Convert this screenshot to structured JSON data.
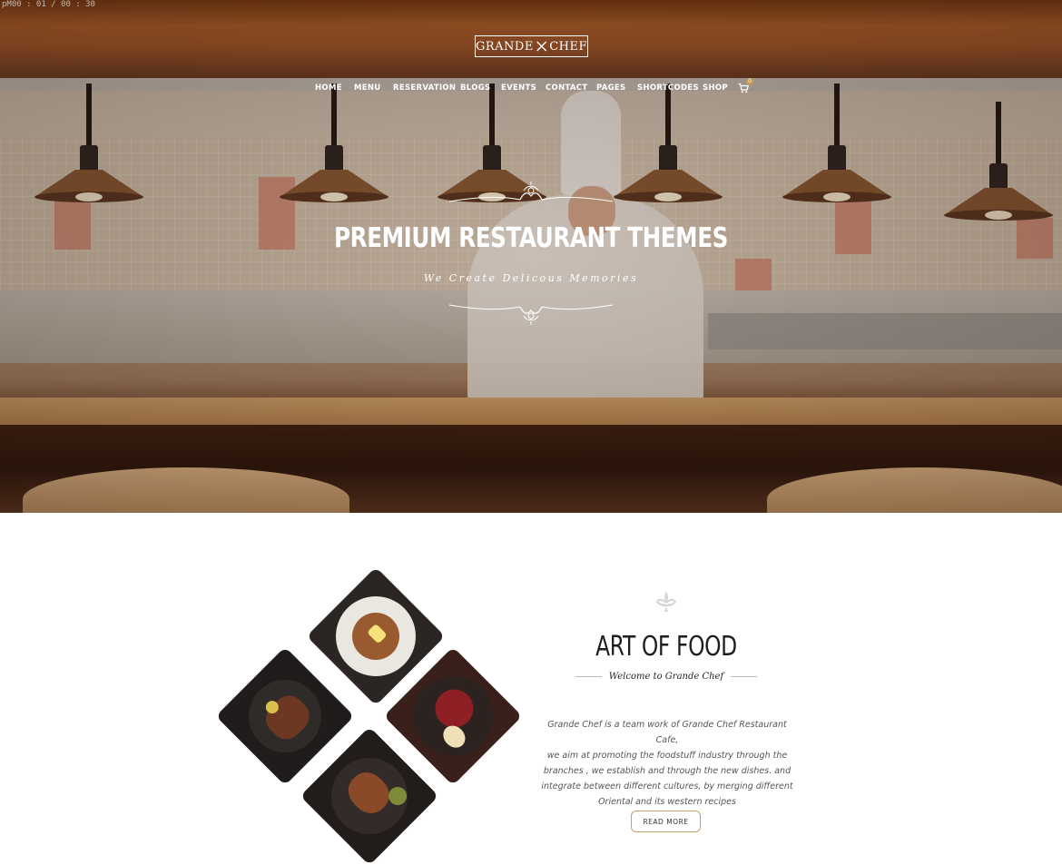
{
  "player": {
    "timecode": "pM00 : 01 / 00 : 30"
  },
  "brand": {
    "logo_left": "GRANDE",
    "logo_right": "CHEF"
  },
  "nav": {
    "items": [
      "HOME",
      "MENU",
      "RESERVATION",
      "BLOGS",
      "EVENTS",
      "CONTACT",
      "PAGES",
      "SHORTCODES",
      "SHOP"
    ],
    "cart_count": "0"
  },
  "hero": {
    "title": "PREMIUM RESTAURANT THEMES",
    "subtitle": "We Create Delicous Memories"
  },
  "about": {
    "title": "ART OF FOOD",
    "subtitle": "Welcome to Grande Chef",
    "body_lines": [
      "Grande Chef is a team work of Grande Chef Restaurant Cafe,",
      "we aim at promoting the foodstuff industry through the",
      "branches , we establish and through the new dishes. and",
      "integrate between different cultures, by merging different",
      "Oriental and its western recipes"
    ],
    "button": "READ MORE"
  },
  "colors": {
    "accent": "#c8a06a",
    "text_dark": "#1e1e1e",
    "body_text": "#555555"
  }
}
